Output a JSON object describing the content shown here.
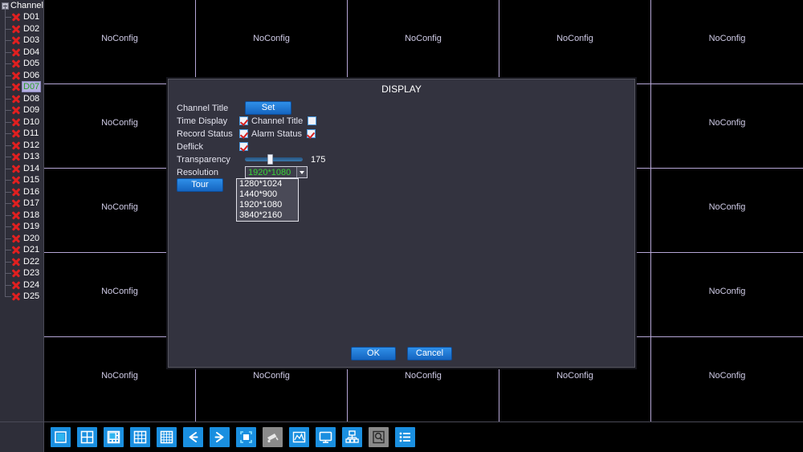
{
  "sidebar": {
    "header": {
      "label": "Channel",
      "icon": "tree-node-icon"
    },
    "channels": [
      {
        "name": "D01",
        "selected": false
      },
      {
        "name": "D02",
        "selected": false
      },
      {
        "name": "D03",
        "selected": false
      },
      {
        "name": "D04",
        "selected": false
      },
      {
        "name": "D05",
        "selected": false
      },
      {
        "name": "D06",
        "selected": false
      },
      {
        "name": "D07",
        "selected": true
      },
      {
        "name": "D08",
        "selected": false
      },
      {
        "name": "D09",
        "selected": false
      },
      {
        "name": "D10",
        "selected": false
      },
      {
        "name": "D11",
        "selected": false
      },
      {
        "name": "D12",
        "selected": false
      },
      {
        "name": "D13",
        "selected": false
      },
      {
        "name": "D14",
        "selected": false
      },
      {
        "name": "D15",
        "selected": false
      },
      {
        "name": "D16",
        "selected": false
      },
      {
        "name": "D17",
        "selected": false
      },
      {
        "name": "D18",
        "selected": false
      },
      {
        "name": "D19",
        "selected": false
      },
      {
        "name": "D20",
        "selected": false
      },
      {
        "name": "D21",
        "selected": false
      },
      {
        "name": "D22",
        "selected": false
      },
      {
        "name": "D23",
        "selected": false
      },
      {
        "name": "D24",
        "selected": false
      },
      {
        "name": "D25",
        "selected": false
      }
    ]
  },
  "grid": {
    "rows": 5,
    "cols": 5,
    "cell_label": "NoConfig",
    "line_color": "#b5a6d6",
    "cells": [
      "NoConfig",
      "NoConfig",
      "NoConfig",
      "NoConfig",
      "NoConfig",
      "NoConfig",
      "NoConfig",
      "NoConfig",
      "NoConfig",
      "NoConfig",
      "NoConfig",
      "NoConfig",
      "NoConfig",
      "NoConfig",
      "NoConfig",
      "NoConfig",
      "NoConfig",
      "NoConfig",
      "NoConfig",
      "NoConfig",
      "NoConfig",
      "NoConfig",
      "NoConfig",
      "NoConfig",
      "NoConfig"
    ]
  },
  "dialog": {
    "title": "DISPLAY",
    "channel_title": {
      "label": "Channel Title",
      "button": "Set"
    },
    "time_display": {
      "label": "Time Display",
      "checked": true
    },
    "channel_title_cb": {
      "label": "Channel Title",
      "checked": false
    },
    "record_status": {
      "label": "Record Status",
      "checked": true
    },
    "alarm_status": {
      "label": "Alarm Status",
      "checked": true
    },
    "deflick": {
      "label": "Deflick",
      "checked": true
    },
    "transparency": {
      "label": "Transparency",
      "value": "175"
    },
    "resolution": {
      "label": "Resolution",
      "selected": "1920*1080",
      "options": [
        "1280*1024",
        "1440*900",
        "1920*1080",
        "3840*2160"
      ],
      "value_color": "#38d438"
    },
    "tour_button": "Tour",
    "ok_button": "OK",
    "cancel_button": "Cancel"
  },
  "toolbar": {
    "buttons": [
      {
        "name": "view-1-icon",
        "style": "blue"
      },
      {
        "name": "view-4-icon",
        "style": "blue"
      },
      {
        "name": "view-8-icon",
        "style": "blue"
      },
      {
        "name": "view-9-icon",
        "style": "blue"
      },
      {
        "name": "view-16-icon",
        "style": "blue"
      },
      {
        "name": "prev-page-icon",
        "style": "blue"
      },
      {
        "name": "next-page-icon",
        "style": "blue"
      },
      {
        "name": "tour-icon",
        "style": "blue"
      },
      {
        "name": "ptz-camera-icon",
        "style": "grey"
      },
      {
        "name": "color-setting-icon",
        "style": "blue"
      },
      {
        "name": "display-icon",
        "style": "blue"
      },
      {
        "name": "network-icon",
        "style": "blue"
      },
      {
        "name": "hdd-search-icon",
        "style": "grey"
      },
      {
        "name": "main-menu-icon",
        "style": "blue"
      }
    ]
  }
}
